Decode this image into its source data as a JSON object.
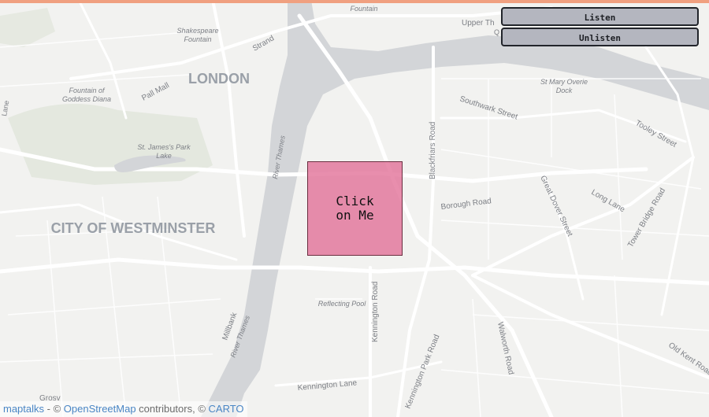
{
  "map": {
    "labels": {
      "london": "LONDON",
      "westminster": "CITY OF WESTMINSTER",
      "shakespeare_fountain": "Shakespeare\nFountain",
      "fountain_top": "Fountain",
      "fountain_diana": "Fountain of\nGoddess Diana",
      "pall_mall": "Pall Mall",
      "st_james_lake": "St. James's Park\nLake",
      "strand": "Strand",
      "river_thames_1": "River Thames",
      "river_thames_2": "River Thames",
      "millbank": "Millbank",
      "blackfriars_road": "Blackfriars Road",
      "southwark_street": "Southwark Street",
      "st_mary_overie": "St Mary Overie\nDock",
      "tooley_street": "Tooley Street",
      "great_dover_street": "Great Dover Street",
      "long_lane": "Long Lane",
      "tower_bridge_road": "Tower Bridge Road",
      "borough_road": "Borough Road",
      "kennington_road": "Kennington Road",
      "kennington_park_road": "Kennington Park Road",
      "walworth_road": "Walworth Road",
      "old_kent_road": "Old Kent Road",
      "kennington_lane": "Kennington Lane",
      "reflecting_pool": "Reflecting Pool",
      "upper_th": "Upper Th",
      "grosv": "Grosv",
      "lane": "Lane",
      "q": "Q"
    }
  },
  "controls": {
    "listen_label": "Listen",
    "unlisten_label": "Unlisten"
  },
  "marker": {
    "label": "Click on Me"
  },
  "attribution": {
    "maptalks": "maptalks",
    "sep1": " - © ",
    "osm": "OpenStreetMap",
    "middle": " contributors, © ",
    "carto": "CARTO"
  }
}
